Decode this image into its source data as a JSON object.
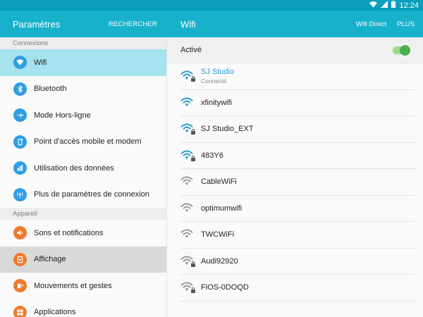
{
  "status_bar": {
    "time": "12:24"
  },
  "left_header": {
    "title": "Paramètres",
    "search_label": "RECHERCHER"
  },
  "right_header": {
    "title": "Wifi",
    "wifi_direct_label": "Wifi Direct",
    "more_label": "PLUS"
  },
  "sections": {
    "connexions": {
      "title": "Connexions",
      "items": [
        {
          "label": "Wifi",
          "icon": "wifi-icon"
        },
        {
          "label": "Bluetooth",
          "icon": "bluetooth-icon"
        },
        {
          "label": "Mode Hors-ligne",
          "icon": "airplane-icon"
        },
        {
          "label": "Point d'accès mobile et modem",
          "icon": "hotspot-icon"
        },
        {
          "label": "Utilisation des données",
          "icon": "data-usage-icon"
        },
        {
          "label": "Plus de paramètres de connexion",
          "icon": "more-connections-icon"
        }
      ]
    },
    "appareil": {
      "title": "Appareil",
      "items": [
        {
          "label": "Sons et notifications",
          "icon": "sound-icon"
        },
        {
          "label": "Affichage",
          "icon": "display-icon"
        },
        {
          "label": "Mouvements et gestes",
          "icon": "motion-icon"
        },
        {
          "label": "Applications",
          "icon": "apps-icon"
        }
      ]
    }
  },
  "wifi": {
    "toggle_label": "Activé",
    "enabled": true,
    "networks": [
      {
        "name": "SJ Studio",
        "status": "Connecté",
        "secured": true,
        "signal_color": "#2a9ed5"
      },
      {
        "name": "xfinitywifi",
        "secured": false,
        "signal_color": "#2a9ed5"
      },
      {
        "name": "SJ Studio_EXT",
        "secured": true,
        "signal_color": "#2a9ed5"
      },
      {
        "name": "483Y6",
        "secured": true,
        "signal_color": "#2a9ed5"
      },
      {
        "name": "CableWiFi",
        "secured": false,
        "signal_color": "#9a9a9a"
      },
      {
        "name": "optimumwifi",
        "secured": false,
        "signal_color": "#9a9a9a"
      },
      {
        "name": "TWCWiFi",
        "secured": false,
        "signal_color": "#9a9a9a"
      },
      {
        "name": "Audi92920",
        "secured": true,
        "signal_color": "#9a9a9a"
      },
      {
        "name": "FiOS-0DOQD",
        "secured": true,
        "signal_color": "#9a9a9a"
      }
    ]
  },
  "colors": {
    "accent": "#18b1cc",
    "statusbar": "#0a9fbc",
    "active_row": "#a6e3ee",
    "connected_text": "#2a9ed5"
  }
}
